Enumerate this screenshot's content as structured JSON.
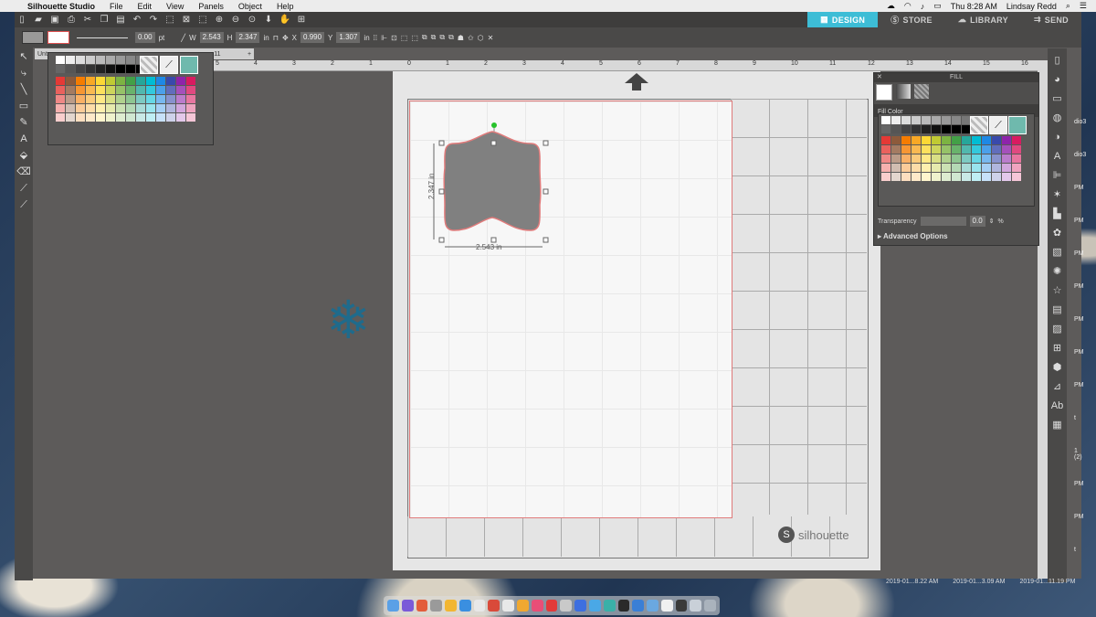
{
  "menubar": {
    "app": "Silhouette Studio",
    "items": [
      "File",
      "Edit",
      "View",
      "Panels",
      "Object",
      "Help"
    ],
    "clock": "Thu 8:28 AM",
    "user": "Lindsay Redd"
  },
  "tabs": [
    "DESIGN",
    "STORE",
    "LIBRARY",
    "SEND"
  ],
  "toolbar2": {
    "line_width": "0.00",
    "line_unit": "pt",
    "w_label": "W",
    "w_value": "2.543",
    "h_label": "H",
    "h_value": "2.347",
    "h_unit": "in",
    "x_label": "X",
    "x_value": "0.990",
    "y_label": "Y",
    "y_value": "1.307",
    "y_unit": "in"
  },
  "doc_tab": {
    "name": "Unt",
    "suffix": "-11",
    "plus": "+"
  },
  "ruler_top": [
    "5",
    "4",
    "3",
    "2",
    "1",
    "0",
    "1",
    "2",
    "3",
    "4",
    "5",
    "6",
    "7",
    "8",
    "9",
    "10",
    "11",
    "12",
    "13",
    "14",
    "15",
    "16"
  ],
  "shape": {
    "width_label": "2.543 in",
    "height_label": "2.347 in"
  },
  "fill_panel": {
    "title": "FILL",
    "section": "Fill Color",
    "transparency_label": "Transparency",
    "transparency_value": "0.0",
    "transparency_unit": "%",
    "advanced": "Advanced Options"
  },
  "brand": "silhouette",
  "edge_labels": [
    "dio3",
    "dio3",
    "PM",
    "PM",
    "PM",
    "PM",
    "PM",
    "PM",
    "PM",
    "t",
    "1 (2)",
    "PM",
    "PM",
    "t"
  ],
  "timestamps": [
    "2019-01...8.22 AM",
    "2019-01...3.09 AM",
    "2019-01...11.19 PM"
  ],
  "colors": {
    "design_tab": "#3dbdd6",
    "snowflake": "#1f6b8c",
    "shape_fill": "#808080",
    "shape_stroke": "#e07b7b",
    "teal_swatch": "#6fb9ad"
  }
}
